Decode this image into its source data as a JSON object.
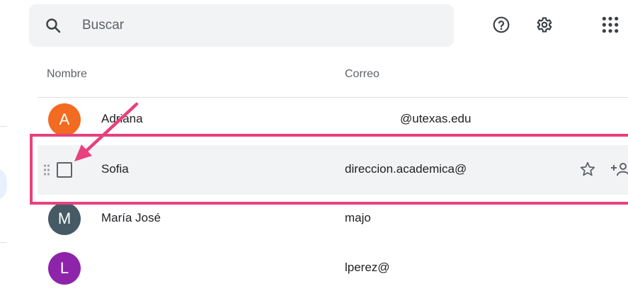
{
  "search": {
    "placeholder": "Buscar"
  },
  "toolbar": {
    "help_icon": "help-icon",
    "settings_icon": "gear-icon",
    "apps_icon": "apps-grid-icon"
  },
  "table": {
    "headers": {
      "name": "Nombre",
      "email": "Correo"
    },
    "rows": [
      {
        "initial": "A",
        "avatar_color": "#f26b21",
        "name": "Adriana",
        "email": "@utexas.edu"
      },
      {
        "initial": "",
        "avatar_color": "",
        "name": "Sofia",
        "email": "direccion.academica@",
        "selected": true
      },
      {
        "initial": "M",
        "avatar_color": "#455a64",
        "name": "María José",
        "email": "majo"
      },
      {
        "initial": "L",
        "avatar_color": "#8e24aa",
        "name": "",
        "email": "lperez@"
      }
    ]
  },
  "annotation": {
    "highlight_color": "#e8417d"
  }
}
